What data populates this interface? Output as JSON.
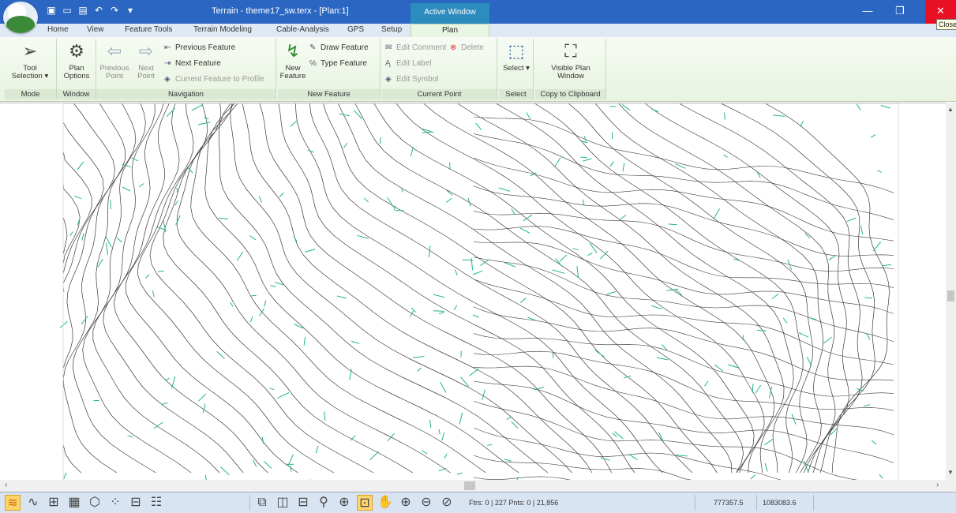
{
  "titlebar": {
    "title": "Terrain - theme17_sw.terx - [Plan:1]",
    "context_tab": "Active Window",
    "close_tooltip": "Close",
    "min_glyph": "—",
    "restore_glyph": "❐",
    "close_glyph": "✕"
  },
  "ribbon_tabs": [
    "Home",
    "View",
    "Feature Tools",
    "Terrain Modeling",
    "Cable-Analysis",
    "GPS",
    "Setup"
  ],
  "active_tab": "Plan",
  "ribbon_minimize": "–",
  "groups": {
    "mode": {
      "label": "Mode",
      "tool_selection": "Tool Selection ▾"
    },
    "window": {
      "label": "Window",
      "plan_options": "Plan Options"
    },
    "navigation": {
      "label": "Navigation",
      "previous_point": "Previous Point",
      "next_point": "Next Point",
      "previous_feature": "Previous Feature",
      "next_feature": "Next Feature",
      "current_feature_to_profile": "Current Feature to Profile"
    },
    "new_feature": {
      "label": "New Feature",
      "new_feature": "New Feature",
      "draw_feature": "Draw Feature",
      "type_feature": "Type Feature"
    },
    "current_point": {
      "label": "Current Point",
      "edit_comment": "Edit Comment",
      "delete": "Delete",
      "edit_label": "Edit Label",
      "edit_symbol": "Edit Symbol"
    },
    "select": {
      "label": "Select",
      "select": "Select ▾"
    },
    "clipboard": {
      "label": "Copy to Clipboard",
      "visible_plan_window": "Visible Plan Window"
    }
  },
  "statusbar": {
    "counts": "Ftrs: 0 | 227  Pnts: 0 | 21,856",
    "x_coord": "777357.5",
    "y_coord": "1083083.6"
  },
  "colors": {
    "titlebar": "#2b67c2",
    "close": "#e81123",
    "ribbon": "#e8f3e1",
    "contour": "#3a3a3a",
    "tick": "#1fb58a"
  }
}
